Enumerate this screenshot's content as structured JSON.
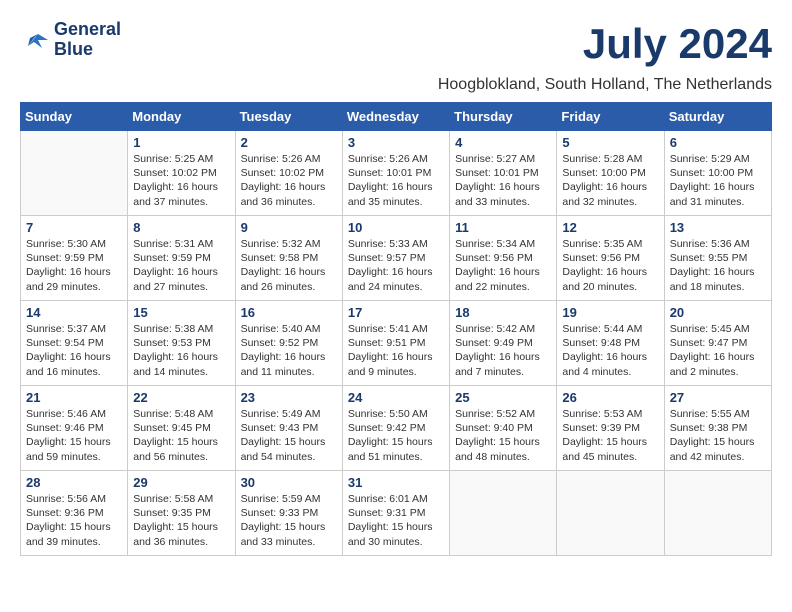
{
  "header": {
    "logo_line1": "General",
    "logo_line2": "Blue",
    "month": "July 2024",
    "location": "Hoogblokland, South Holland, The Netherlands"
  },
  "weekdays": [
    "Sunday",
    "Monday",
    "Tuesday",
    "Wednesday",
    "Thursday",
    "Friday",
    "Saturday"
  ],
  "weeks": [
    [
      {
        "day": "",
        "info": ""
      },
      {
        "day": "1",
        "info": "Sunrise: 5:25 AM\nSunset: 10:02 PM\nDaylight: 16 hours\nand 37 minutes."
      },
      {
        "day": "2",
        "info": "Sunrise: 5:26 AM\nSunset: 10:02 PM\nDaylight: 16 hours\nand 36 minutes."
      },
      {
        "day": "3",
        "info": "Sunrise: 5:26 AM\nSunset: 10:01 PM\nDaylight: 16 hours\nand 35 minutes."
      },
      {
        "day": "4",
        "info": "Sunrise: 5:27 AM\nSunset: 10:01 PM\nDaylight: 16 hours\nand 33 minutes."
      },
      {
        "day": "5",
        "info": "Sunrise: 5:28 AM\nSunset: 10:00 PM\nDaylight: 16 hours\nand 32 minutes."
      },
      {
        "day": "6",
        "info": "Sunrise: 5:29 AM\nSunset: 10:00 PM\nDaylight: 16 hours\nand 31 minutes."
      }
    ],
    [
      {
        "day": "7",
        "info": "Sunrise: 5:30 AM\nSunset: 9:59 PM\nDaylight: 16 hours\nand 29 minutes."
      },
      {
        "day": "8",
        "info": "Sunrise: 5:31 AM\nSunset: 9:59 PM\nDaylight: 16 hours\nand 27 minutes."
      },
      {
        "day": "9",
        "info": "Sunrise: 5:32 AM\nSunset: 9:58 PM\nDaylight: 16 hours\nand 26 minutes."
      },
      {
        "day": "10",
        "info": "Sunrise: 5:33 AM\nSunset: 9:57 PM\nDaylight: 16 hours\nand 24 minutes."
      },
      {
        "day": "11",
        "info": "Sunrise: 5:34 AM\nSunset: 9:56 PM\nDaylight: 16 hours\nand 22 minutes."
      },
      {
        "day": "12",
        "info": "Sunrise: 5:35 AM\nSunset: 9:56 PM\nDaylight: 16 hours\nand 20 minutes."
      },
      {
        "day": "13",
        "info": "Sunrise: 5:36 AM\nSunset: 9:55 PM\nDaylight: 16 hours\nand 18 minutes."
      }
    ],
    [
      {
        "day": "14",
        "info": "Sunrise: 5:37 AM\nSunset: 9:54 PM\nDaylight: 16 hours\nand 16 minutes."
      },
      {
        "day": "15",
        "info": "Sunrise: 5:38 AM\nSunset: 9:53 PM\nDaylight: 16 hours\nand 14 minutes."
      },
      {
        "day": "16",
        "info": "Sunrise: 5:40 AM\nSunset: 9:52 PM\nDaylight: 16 hours\nand 11 minutes."
      },
      {
        "day": "17",
        "info": "Sunrise: 5:41 AM\nSunset: 9:51 PM\nDaylight: 16 hours\nand 9 minutes."
      },
      {
        "day": "18",
        "info": "Sunrise: 5:42 AM\nSunset: 9:49 PM\nDaylight: 16 hours\nand 7 minutes."
      },
      {
        "day": "19",
        "info": "Sunrise: 5:44 AM\nSunset: 9:48 PM\nDaylight: 16 hours\nand 4 minutes."
      },
      {
        "day": "20",
        "info": "Sunrise: 5:45 AM\nSunset: 9:47 PM\nDaylight: 16 hours\nand 2 minutes."
      }
    ],
    [
      {
        "day": "21",
        "info": "Sunrise: 5:46 AM\nSunset: 9:46 PM\nDaylight: 15 hours\nand 59 minutes."
      },
      {
        "day": "22",
        "info": "Sunrise: 5:48 AM\nSunset: 9:45 PM\nDaylight: 15 hours\nand 56 minutes."
      },
      {
        "day": "23",
        "info": "Sunrise: 5:49 AM\nSunset: 9:43 PM\nDaylight: 15 hours\nand 54 minutes."
      },
      {
        "day": "24",
        "info": "Sunrise: 5:50 AM\nSunset: 9:42 PM\nDaylight: 15 hours\nand 51 minutes."
      },
      {
        "day": "25",
        "info": "Sunrise: 5:52 AM\nSunset: 9:40 PM\nDaylight: 15 hours\nand 48 minutes."
      },
      {
        "day": "26",
        "info": "Sunrise: 5:53 AM\nSunset: 9:39 PM\nDaylight: 15 hours\nand 45 minutes."
      },
      {
        "day": "27",
        "info": "Sunrise: 5:55 AM\nSunset: 9:38 PM\nDaylight: 15 hours\nand 42 minutes."
      }
    ],
    [
      {
        "day": "28",
        "info": "Sunrise: 5:56 AM\nSunset: 9:36 PM\nDaylight: 15 hours\nand 39 minutes."
      },
      {
        "day": "29",
        "info": "Sunrise: 5:58 AM\nSunset: 9:35 PM\nDaylight: 15 hours\nand 36 minutes."
      },
      {
        "day": "30",
        "info": "Sunrise: 5:59 AM\nSunset: 9:33 PM\nDaylight: 15 hours\nand 33 minutes."
      },
      {
        "day": "31",
        "info": "Sunrise: 6:01 AM\nSunset: 9:31 PM\nDaylight: 15 hours\nand 30 minutes."
      },
      {
        "day": "",
        "info": ""
      },
      {
        "day": "",
        "info": ""
      },
      {
        "day": "",
        "info": ""
      }
    ]
  ]
}
